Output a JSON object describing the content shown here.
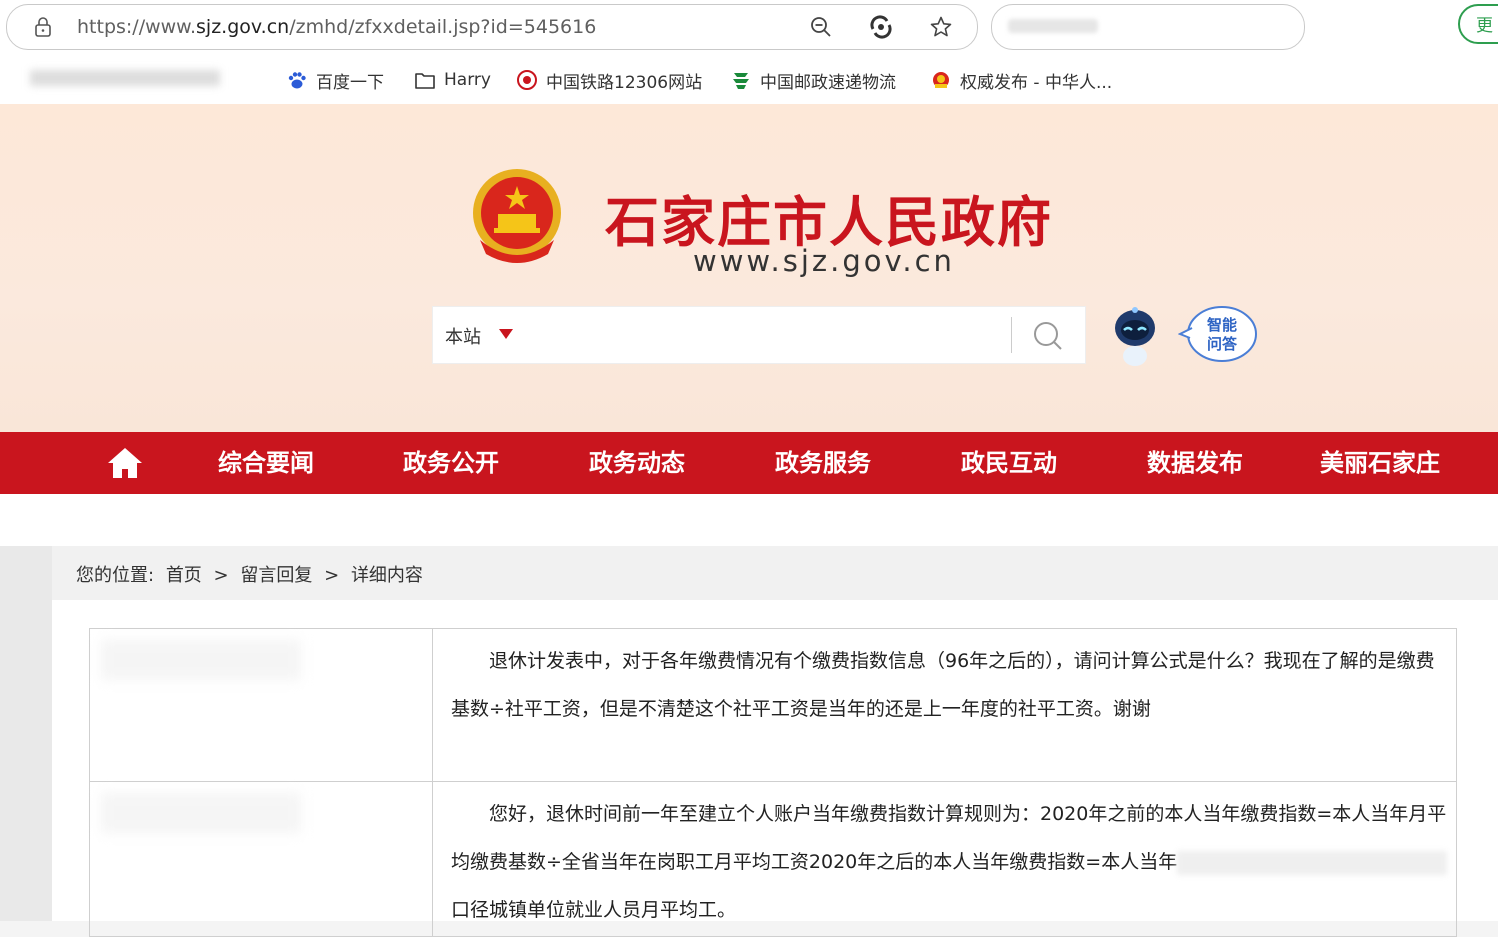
{
  "browser": {
    "url_prefix": "https://www.",
    "url_domain": "sjz.gov.cn",
    "url_path": "/zmhd/zfxxdetail.jsp?id=545616",
    "update_button": "更",
    "bookmarks": [
      {
        "label": "百度一下",
        "icon": "baidu-paw-icon"
      },
      {
        "label": "Harry",
        "icon": "folder-icon"
      },
      {
        "label": "中国铁路12306网站",
        "icon": "railway-logo-icon"
      },
      {
        "label": "中国邮政速递物流",
        "icon": "china-post-logo-icon"
      },
      {
        "label": "权威发布 - 中华人...",
        "icon": "national-emblem-icon"
      }
    ]
  },
  "site": {
    "title": "石家庄市人民政府",
    "domain": "www.sjz.gov.cn",
    "search_scope": "本站",
    "search_placeholder": "",
    "qa_label_line1": "智能",
    "qa_label_line2": "问答"
  },
  "nav": {
    "items": [
      "综合要闻",
      "政务公开",
      "政务动态",
      "政务服务",
      "政民互动",
      "数据发布",
      "美丽石家庄"
    ]
  },
  "breadcrumb": {
    "prefix": "您的位置:",
    "home": "首页",
    "sep": ">",
    "section": "留言回复",
    "current": "详细内容"
  },
  "messages": {
    "question": "退休计发表中，对于各年缴费情况有个缴费指数信息（96年之后的），请问计算公式是什么？我现在了解的是缴费基数÷社平工资，但是不清楚这个社平工资是当年的还是上一年度的社平工资。谢谢",
    "reply_part1": "您好，退休时间前一年至建立个人账户当年缴费指数计算规则为：2020年之前的本人当年缴费指数=本人当年月平均缴费基数÷全省当年在岗职工月平均工资2020年之后的本人当年缴费指数=本人当年",
    "reply_part2": "口径城镇单位就业人员月平均工。"
  },
  "colors": {
    "brand_red": "#c9151e",
    "header_bg": "#fbe9dd",
    "update_green": "#2e9e4f"
  }
}
